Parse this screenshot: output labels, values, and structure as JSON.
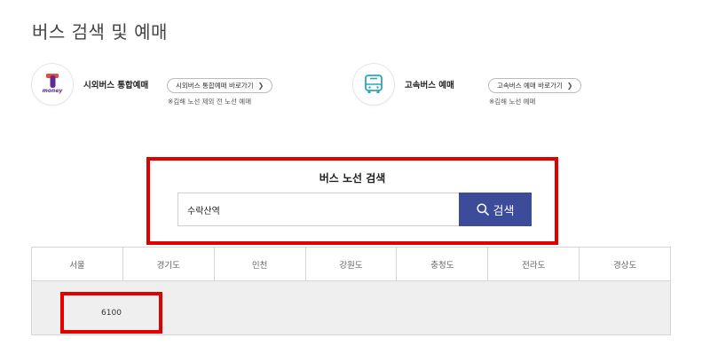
{
  "page": {
    "title": "버스 검색 및 예매"
  },
  "services": {
    "tmoney": {
      "logo_text": "money",
      "title": "시외버스 통합예매",
      "link_label": "시외버스 통합예매 바로가기",
      "note": "※김해 노선 제외 전 노선 예매",
      "brand_color": "#5b2d8e",
      "accent_color": "#e94c3d"
    },
    "express": {
      "title": "고속버스 예매",
      "link_label": "고속버스 예매 바로가기",
      "note": "※김해 노선 예매",
      "icon_color": "#2aa7b8"
    }
  },
  "search": {
    "heading": "버스 노선 검색",
    "input_value": "수락산역",
    "button_label": "검색",
    "button_color": "#3c4b9a"
  },
  "regions": {
    "tabs": [
      {
        "label": "서울",
        "selected": true
      },
      {
        "label": "경기도",
        "selected": false
      },
      {
        "label": "인천",
        "selected": false
      },
      {
        "label": "강원도",
        "selected": false
      },
      {
        "label": "충청도",
        "selected": false
      },
      {
        "label": "전라도",
        "selected": false
      },
      {
        "label": "경상도",
        "selected": false
      }
    ]
  },
  "routes": [
    {
      "label": "6100"
    }
  ],
  "highlight_color": "#e00000"
}
